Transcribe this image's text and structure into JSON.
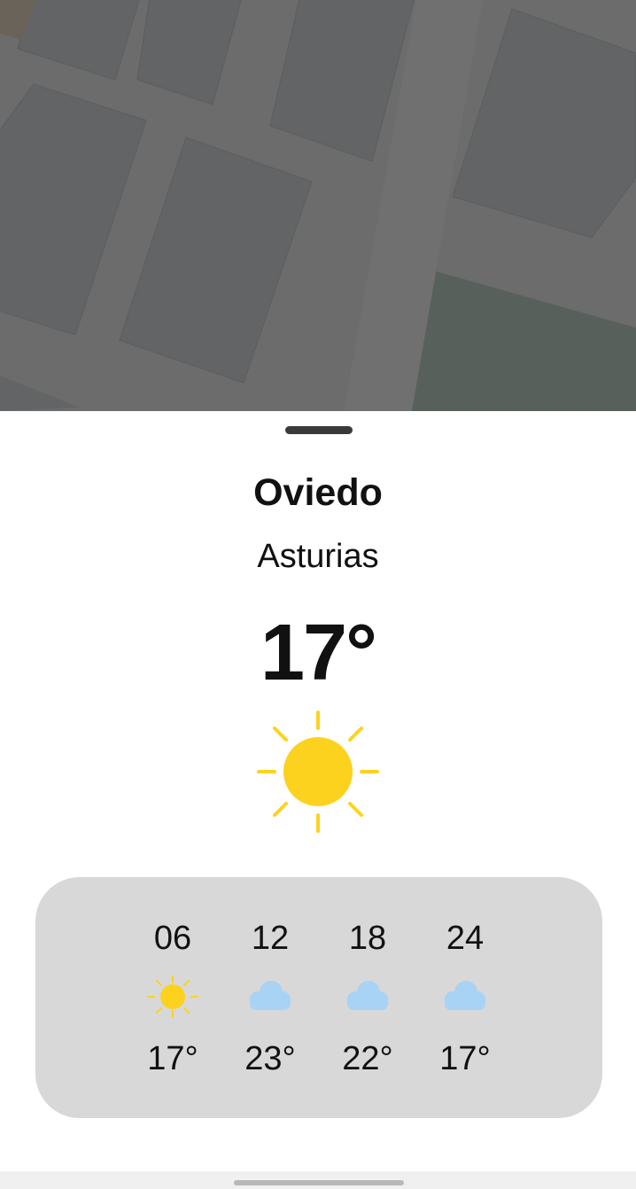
{
  "location": {
    "city": "Oviedo",
    "region": "Asturias"
  },
  "current": {
    "temperature": "17°",
    "condition_icon": "sun-icon"
  },
  "forecast": [
    {
      "hour": "06",
      "icon": "sun-icon",
      "temperature": "17°"
    },
    {
      "hour": "12",
      "icon": "cloud-icon",
      "temperature": "23°"
    },
    {
      "hour": "18",
      "icon": "cloud-icon",
      "temperature": "22°"
    },
    {
      "hour": "24",
      "icon": "cloud-icon",
      "temperature": "17°"
    }
  ],
  "colors": {
    "sun": "#fdd21f",
    "cloud": "#a8d3f5",
    "forecast_panel": "#d8d8d8",
    "map_overlay": "#6a6b6a"
  }
}
